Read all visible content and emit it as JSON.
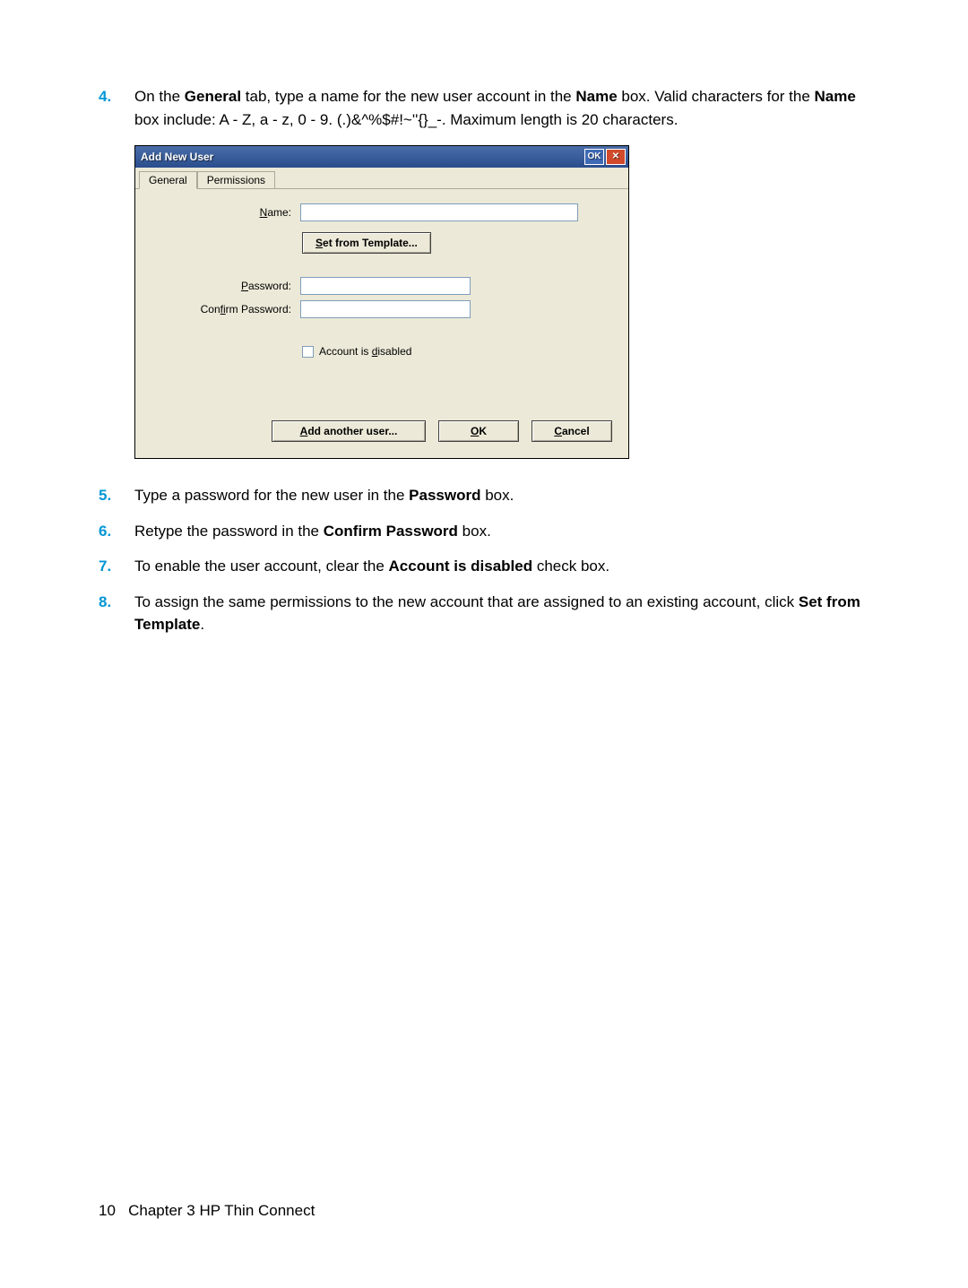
{
  "steps": {
    "s4": {
      "num": "4.",
      "text_pre": "On the ",
      "b1": "General",
      "t1": " tab, type a name for the new user account in the ",
      "b2": "Name",
      "t2": " box. Valid characters for the ",
      "b3": "Name",
      "t3": " box include: A - Z, a - z, 0 - 9. (.)&^%$#!~''{}_-. Maximum length is 20 characters."
    },
    "s5": {
      "num": "5.",
      "t0": "Type a password for the new user in the ",
      "b1": "Password",
      "t1": " box."
    },
    "s6": {
      "num": "6.",
      "t0": "Retype the password in the ",
      "b1": "Confirm Password",
      "t1": " box."
    },
    "s7": {
      "num": "7.",
      "t0": "To enable the user account, clear the ",
      "b1": "Account is disabled",
      "t1": " check box."
    },
    "s8": {
      "num": "8.",
      "t0": "To assign the same permissions to the new account that are assigned to an existing account, click ",
      "b1": "Set from Template",
      "t1": "."
    }
  },
  "dialog": {
    "title": "Add New User",
    "ok_small": "OK",
    "close_x": "✕",
    "tabs": {
      "general": "General",
      "permissions": "Permissions"
    },
    "labels": {
      "name_u": "N",
      "name_rest": "ame:",
      "pass_u": "P",
      "pass_rest": "assword:",
      "conf_pre": "Con",
      "conf_u": "fi",
      "conf_rest": "rm Password:",
      "disabled_pre": "Account is ",
      "disabled_u": "d",
      "disabled_rest": "isabled"
    },
    "buttons": {
      "template_u": "S",
      "template_rest": "et from Template...",
      "add_u": "A",
      "add_rest": "dd another user...",
      "ok_u": "O",
      "ok_rest": "K",
      "cancel_u": "C",
      "cancel_rest": "ancel"
    }
  },
  "footer": {
    "page": "10",
    "chapter": "Chapter 3   HP Thin Connect"
  }
}
